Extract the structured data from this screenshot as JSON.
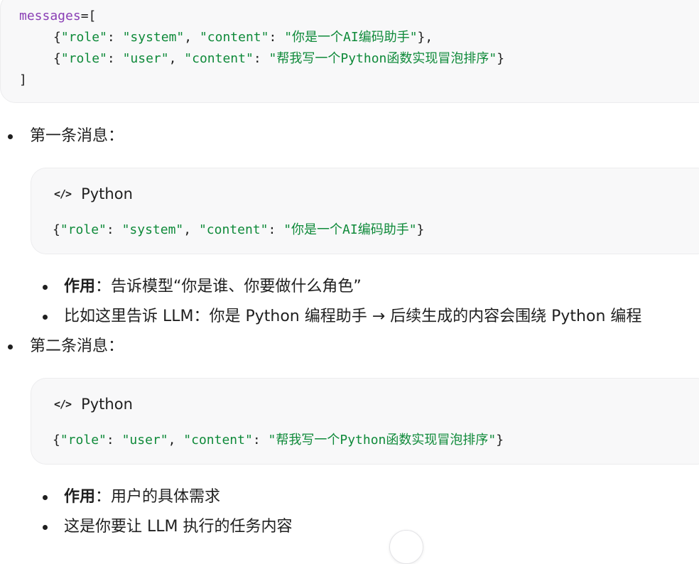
{
  "top_code": {
    "line1_kw": "messages",
    "line1_rest": "=[",
    "line2_pre": "{",
    "line2_k1": "\"role\"",
    "line2_sep1": ": ",
    "line2_v1": "\"system\"",
    "line2_sep2": ", ",
    "line2_k2": "\"content\"",
    "line2_sep3": ": ",
    "line2_v2": "\"你是一个AI编码助手\"",
    "line2_post": "},",
    "line3_pre": "{",
    "line3_k1": "\"role\"",
    "line3_sep1": ": ",
    "line3_v1": "\"user\"",
    "line3_sep2": ", ",
    "line3_k2": "\"content\"",
    "line3_sep3": ": ",
    "line3_v2": "\"帮我写一个Python函数实现冒泡排序\"",
    "line3_post": "}",
    "line4": "]"
  },
  "section1": {
    "title": "第一条消息：",
    "card": {
      "lang_icon": "</>",
      "lang": "Python",
      "pre": "{",
      "k1": "\"role\"",
      "sep1": ": ",
      "v1": "\"system\"",
      "sep2": ", ",
      "k2": "\"content\"",
      "sep3": ": ",
      "v2": "\"你是一个AI编码助手\"",
      "post": "}"
    },
    "bullet1_bold": "作用",
    "bullet1_text": "：告诉模型“你是谁、你要做什么角色”",
    "bullet2_text": "比如这里告诉 LLM：你是 Python 编程助手 → 后续生成的内容会围绕 Python 编程"
  },
  "section2": {
    "title": "第二条消息：",
    "card": {
      "lang_icon": "</>",
      "lang": "Python",
      "pre": "{",
      "k1": "\"role\"",
      "sep1": ": ",
      "v1": "\"user\"",
      "sep2": ", ",
      "k2": "\"content\"",
      "sep3": ": ",
      "v2": "\"帮我写一个Python函数实现冒泡排序\"",
      "post": "}"
    },
    "bullet1_bold": "作用",
    "bullet1_text": "：用户的具体需求",
    "bullet2_text": "这是你要让 LLM 执行的任务内容"
  }
}
